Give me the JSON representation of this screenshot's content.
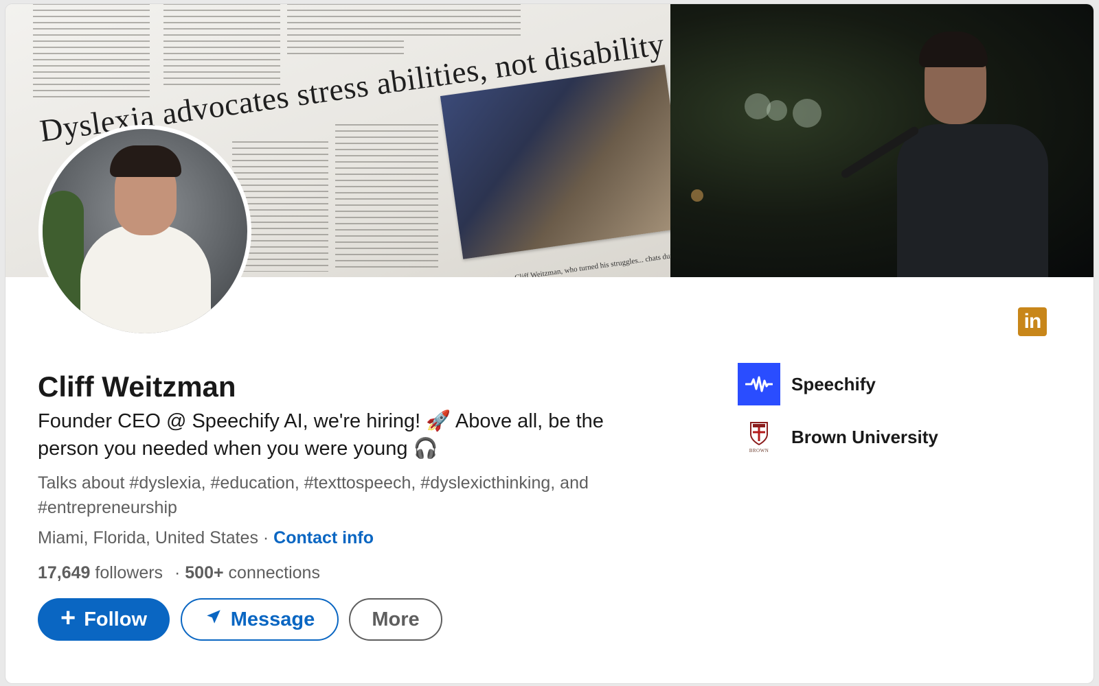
{
  "banner": {
    "headline_text": "Dyslexia advocates stress abilities, not disability",
    "caption_text": "Cliff Weitzman, who turned his struggles... chats during the Dyslexia"
  },
  "profile": {
    "name": "Cliff Weitzman",
    "headline_line1": "Founder CEO @ Speechify AI, we're hiring! 🚀 Above all, be the",
    "headline_line2": "person you needed when you were young 🎧",
    "topics_line1": "Talks about #dyslexia, #education, #texttospeech, #dyslexicthinking, and",
    "topics_line2": "#entrepreneurship",
    "location": "Miami, Florida, United States",
    "separator": " · ",
    "contact_label": "Contact info",
    "followers_count": "17,649",
    "followers_label": " followers",
    "stats_separator": " · ",
    "connections_count": "500+",
    "connections_label": " connections"
  },
  "actions": {
    "follow_label": "Follow",
    "message_label": "Message",
    "more_label": "More"
  },
  "organizations": [
    {
      "name": "Speechify",
      "logo": "speechify-logo"
    },
    {
      "name": "Brown University",
      "logo": "brown-university-logo",
      "logo_caption": "BROWN"
    }
  ],
  "icons": {
    "linkedin_badge": "in"
  },
  "colors": {
    "primary_blue": "#0a66c2",
    "linkedin_badge": "#c8861a",
    "speechify_blue": "#2a4dff"
  }
}
